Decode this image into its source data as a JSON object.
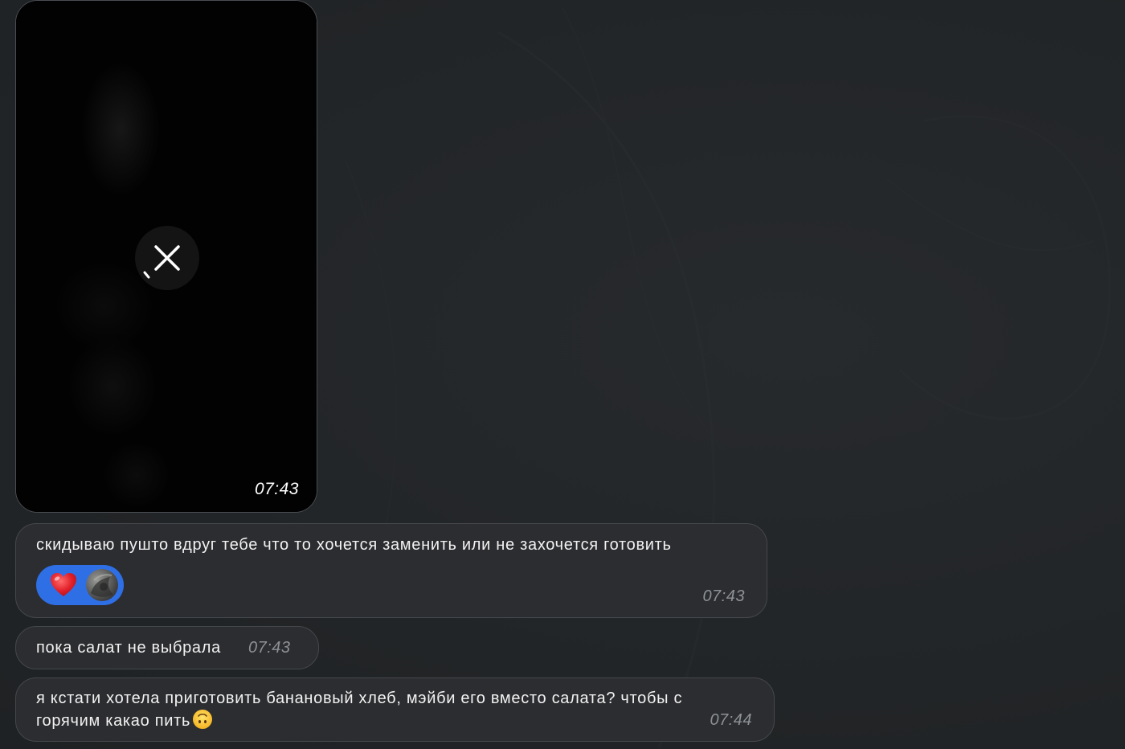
{
  "messages": [
    {
      "type": "media",
      "time": "07:43",
      "action_icon": "close-icon"
    },
    {
      "type": "text",
      "text": "скидываю пушто вдруг тебе что то хочется заменить или не захочется готовить",
      "time": "07:43",
      "reaction": {
        "emoji": "heart-icon",
        "color": "#2f6fe6"
      }
    },
    {
      "type": "text",
      "text": "пока салат не выбрала",
      "time": "07:43"
    },
    {
      "type": "text",
      "line1": "я кстати хотела приготовить банановый хлеб, мэйби его вместо салата? чтобы с",
      "line2": "горячим какао пить",
      "emoji": "upside-down-face-icon",
      "time": "07:44"
    }
  ],
  "colors": {
    "background": "#232628",
    "bubble": "#2c2d30",
    "bubble_border": "#44474b",
    "text": "#f2f2f2",
    "time": "#8d9196",
    "reaction": "#2f6fe6"
  }
}
